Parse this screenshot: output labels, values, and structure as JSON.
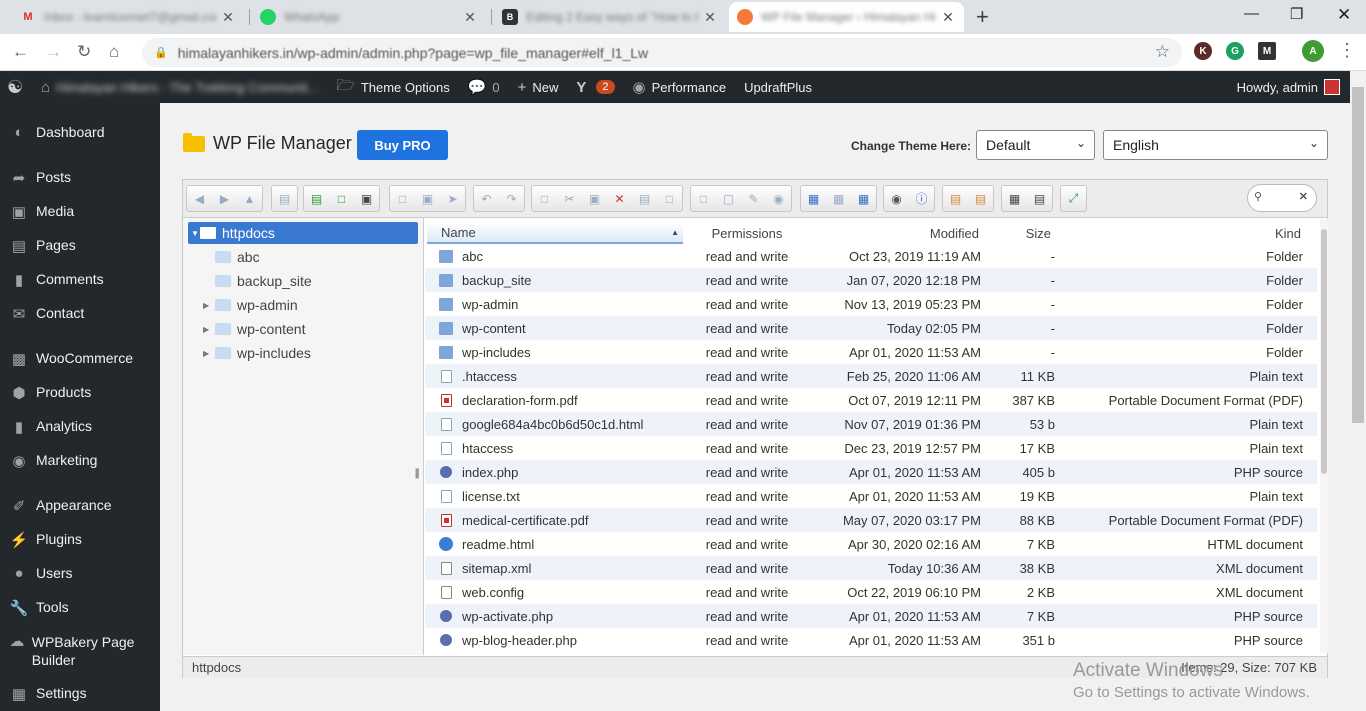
{
  "browser": {
    "tabs": [
      {
        "title": "Inbox - learntosmart7@gmail.com",
        "favicon": "gmail-icon"
      },
      {
        "title": "WhatsApp",
        "favicon": "whatsapp-icon"
      },
      {
        "title": "Editing 2 Easy ways of \"How to F...",
        "favicon": "editor-icon"
      },
      {
        "title": "WP File Manager ‹ Himalayan Hi...",
        "favicon": "wordpress-icon"
      }
    ],
    "address": "himalayanhikers.in/wp-admin/admin.php?page=wp_file_manager#elf_l1_Lw",
    "profile_letter": "A",
    "ext_letter": "K"
  },
  "adminbar": {
    "site_name": "Himalayan Hikers - The Trekking Communit...",
    "theme_options": "Theme Options",
    "comments_count": "0",
    "new_label": "New",
    "yoast_badge": "2",
    "performance": "Performance",
    "updraft": "UpdraftPlus",
    "howdy": "Howdy, admin"
  },
  "sidebar": {
    "items": [
      {
        "label": "Dashboard",
        "icon": "dashboard-icon"
      },
      {
        "label": "Posts",
        "icon": "pin-icon"
      },
      {
        "label": "Media",
        "icon": "media-icon"
      },
      {
        "label": "Pages",
        "icon": "pages-icon"
      },
      {
        "label": "Comments",
        "icon": "comments-icon"
      },
      {
        "label": "Contact",
        "icon": "mail-icon"
      },
      {
        "label": "WooCommerce",
        "icon": "woo-icon"
      },
      {
        "label": "Products",
        "icon": "products-icon"
      },
      {
        "label": "Analytics",
        "icon": "analytics-icon"
      },
      {
        "label": "Marketing",
        "icon": "marketing-icon"
      },
      {
        "label": "Appearance",
        "icon": "appearance-icon"
      },
      {
        "label": "Plugins",
        "icon": "plugins-icon"
      },
      {
        "label": "Users",
        "icon": "users-icon"
      },
      {
        "label": "Tools",
        "icon": "tools-icon"
      },
      {
        "label": "WPBakery Page Builder",
        "icon": "wpbakery-icon"
      },
      {
        "label": "Settings",
        "icon": "settings-icon"
      }
    ]
  },
  "page": {
    "title": "WP File Manager",
    "buy_pro": "Buy PRO",
    "theme_label": "Change Theme Here:",
    "theme_value": "Default",
    "language_value": "English"
  },
  "tree": {
    "root": "httpdocs",
    "children": [
      "abc",
      "backup_site",
      "wp-admin",
      "wp-content",
      "wp-includes"
    ]
  },
  "columns": {
    "name": "Name",
    "permissions": "Permissions",
    "modified": "Modified",
    "size": "Size",
    "kind": "Kind"
  },
  "files": [
    {
      "name": "abc",
      "perm": "read and write",
      "modified": "Oct 23, 2019 11:19 AM",
      "size": "-",
      "kind": "Folder",
      "icon": "folder"
    },
    {
      "name": "backup_site",
      "perm": "read and write",
      "modified": "Jan 07, 2020 12:18 PM",
      "size": "-",
      "kind": "Folder",
      "icon": "folder"
    },
    {
      "name": "wp-admin",
      "perm": "read and write",
      "modified": "Nov 13, 2019 05:23 PM",
      "size": "-",
      "kind": "Folder",
      "icon": "folder"
    },
    {
      "name": "wp-content",
      "perm": "read and write",
      "modified": "Today 02:05 PM",
      "size": "-",
      "kind": "Folder",
      "icon": "folder"
    },
    {
      "name": "wp-includes",
      "perm": "read and write",
      "modified": "Apr 01, 2020 11:53 AM",
      "size": "-",
      "kind": "Folder",
      "icon": "folder"
    },
    {
      "name": ".htaccess",
      "perm": "read and write",
      "modified": "Feb 25, 2020 11:06 AM",
      "size": "11 KB",
      "kind": "Plain text",
      "icon": "text"
    },
    {
      "name": "declaration-form.pdf",
      "perm": "read and write",
      "modified": "Oct 07, 2019 12:11 PM",
      "size": "387 KB",
      "kind": "Portable Document Format (PDF)",
      "icon": "pdf"
    },
    {
      "name": "google684a4bc0b6d50c1d.html",
      "perm": "read and write",
      "modified": "Nov 07, 2019 01:36 PM",
      "size": "53 b",
      "kind": "Plain text",
      "icon": "text"
    },
    {
      "name": "htaccess",
      "perm": "read and write",
      "modified": "Dec 23, 2019 12:57 PM",
      "size": "17 KB",
      "kind": "Plain text",
      "icon": "text"
    },
    {
      "name": "index.php",
      "perm": "read and write",
      "modified": "Apr 01, 2020 11:53 AM",
      "size": "405 b",
      "kind": "PHP source",
      "icon": "php"
    },
    {
      "name": "license.txt",
      "perm": "read and write",
      "modified": "Apr 01, 2020 11:53 AM",
      "size": "19 KB",
      "kind": "Plain text",
      "icon": "text"
    },
    {
      "name": "medical-certificate.pdf",
      "perm": "read and write",
      "modified": "May 07, 2020 03:17 PM",
      "size": "88 KB",
      "kind": "Portable Document Format (PDF)",
      "icon": "pdf"
    },
    {
      "name": "readme.html",
      "perm": "read and write",
      "modified": "Apr 30, 2020 02:16 AM",
      "size": "7 KB",
      "kind": "HTML document",
      "icon": "html"
    },
    {
      "name": "sitemap.xml",
      "perm": "read and write",
      "modified": "Today 10:36 AM",
      "size": "38 KB",
      "kind": "XML document",
      "icon": "xml"
    },
    {
      "name": "web.config",
      "perm": "read and write",
      "modified": "Oct 22, 2019 06:10 PM",
      "size": "2 KB",
      "kind": "XML document",
      "icon": "xml"
    },
    {
      "name": "wp-activate.php",
      "perm": "read and write",
      "modified": "Apr 01, 2020 11:53 AM",
      "size": "7 KB",
      "kind": "PHP source",
      "icon": "php"
    },
    {
      "name": "wp-blog-header.php",
      "perm": "read and write",
      "modified": "Apr 01, 2020 11:53 AM",
      "size": "351 b",
      "kind": "PHP source",
      "icon": "php"
    }
  ],
  "status": {
    "path": "httpdocs",
    "summary": "Items: 29, Size: 707 KB"
  },
  "watermark": {
    "line1": "Activate Windows",
    "line2": "Go to Settings to activate Windows."
  },
  "colors": {
    "admin_bg": "#23282d",
    "accent": "#1e73e0",
    "selection": "#3a79d1"
  }
}
